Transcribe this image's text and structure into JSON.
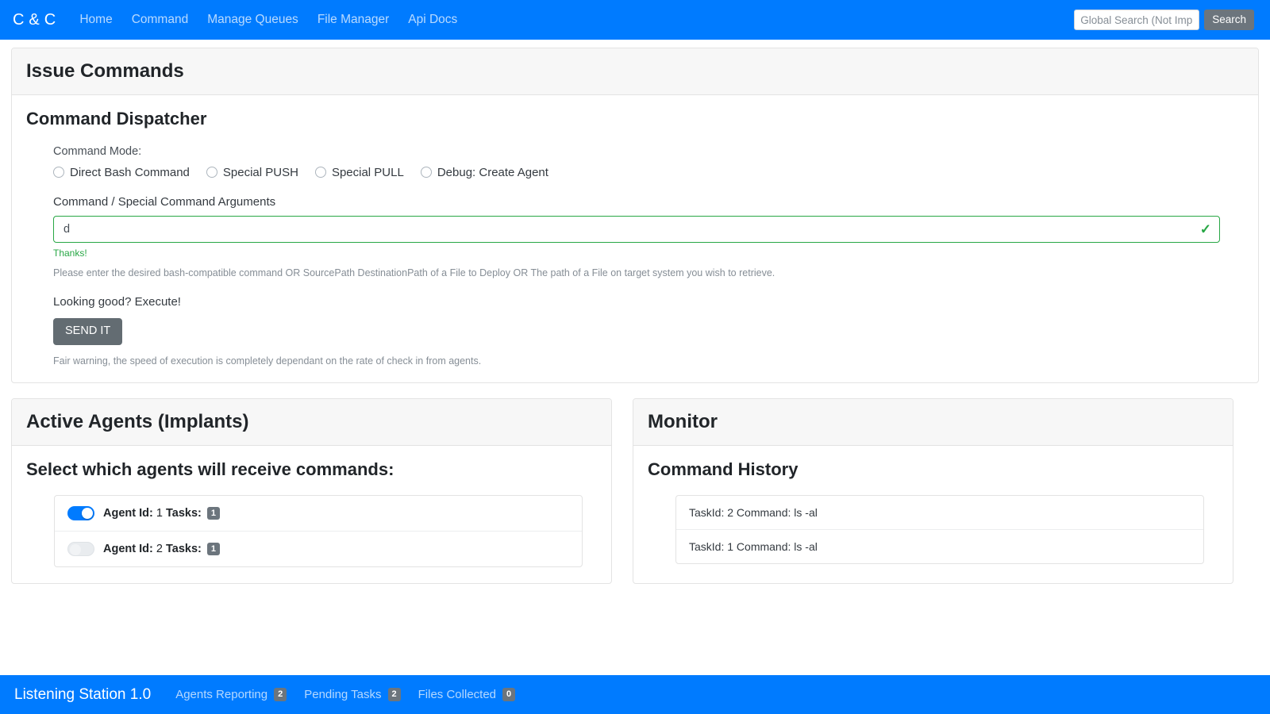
{
  "navbar": {
    "brand": "C & C",
    "links": [
      {
        "label": "Home",
        "name": "nav-link-home"
      },
      {
        "label": "Command",
        "name": "nav-link-command"
      },
      {
        "label": "Manage Queues",
        "name": "nav-link-manage-queues"
      },
      {
        "label": "File Manager",
        "name": "nav-link-file-manager"
      },
      {
        "label": "Api Docs",
        "name": "nav-link-api-docs"
      }
    ],
    "search": {
      "value": "",
      "placeholder": "Global Search (Not Implemented)",
      "button_label": "Search"
    }
  },
  "issue_commands": {
    "card_title": "Issue Commands",
    "section_title": "Command Dispatcher",
    "command_mode_label": "Command Mode:",
    "modes": [
      {
        "label": "Direct Bash Command",
        "checked": false
      },
      {
        "label": "Special PUSH",
        "checked": false
      },
      {
        "label": "Special PULL",
        "checked": false
      },
      {
        "label": "Debug: Create Agent",
        "checked": false
      }
    ],
    "field_label": "Command / Special Command Arguments",
    "command_value": "d",
    "command_placeholder": "",
    "valid_message": "Thanks!",
    "help_text": "Please enter the desired bash-compatible command OR SourcePath DestinationPath of a File to Deploy OR The path of a File on target system you wish to retrieve.",
    "execute_prompt": "Looking good? Execute!",
    "send_button": "SEND IT",
    "warning_text": "Fair warning, the speed of execution is completely dependant on the rate of check in from agents."
  },
  "active_agents": {
    "card_title": "Active Agents (Implants)",
    "section_title": "Select which agents will receive commands:",
    "agents": [
      {
        "id_label": "Agent Id:",
        "id_value": "1",
        "tasks_label": "Tasks:",
        "tasks_count": "1",
        "enabled": true
      },
      {
        "id_label": "Agent Id:",
        "id_value": "2",
        "tasks_label": "Tasks:",
        "tasks_count": "1",
        "enabled": false
      }
    ]
  },
  "monitor": {
    "card_title": "Monitor",
    "section_title": "Command History",
    "history": [
      {
        "text": "TaskId: 2 Command: ls -al"
      },
      {
        "text": "TaskId: 1 Command: ls -al"
      }
    ]
  },
  "footer": {
    "brand": "Listening Station 1.0",
    "stats": [
      {
        "label": "Agents Reporting",
        "count": "2"
      },
      {
        "label": "Pending Tasks",
        "count": "2"
      },
      {
        "label": "Files Collected",
        "count": "0"
      }
    ]
  },
  "colors": {
    "primary": "#007bff",
    "success": "#28a745",
    "secondary": "#6c757d",
    "muted": "#868e96"
  }
}
